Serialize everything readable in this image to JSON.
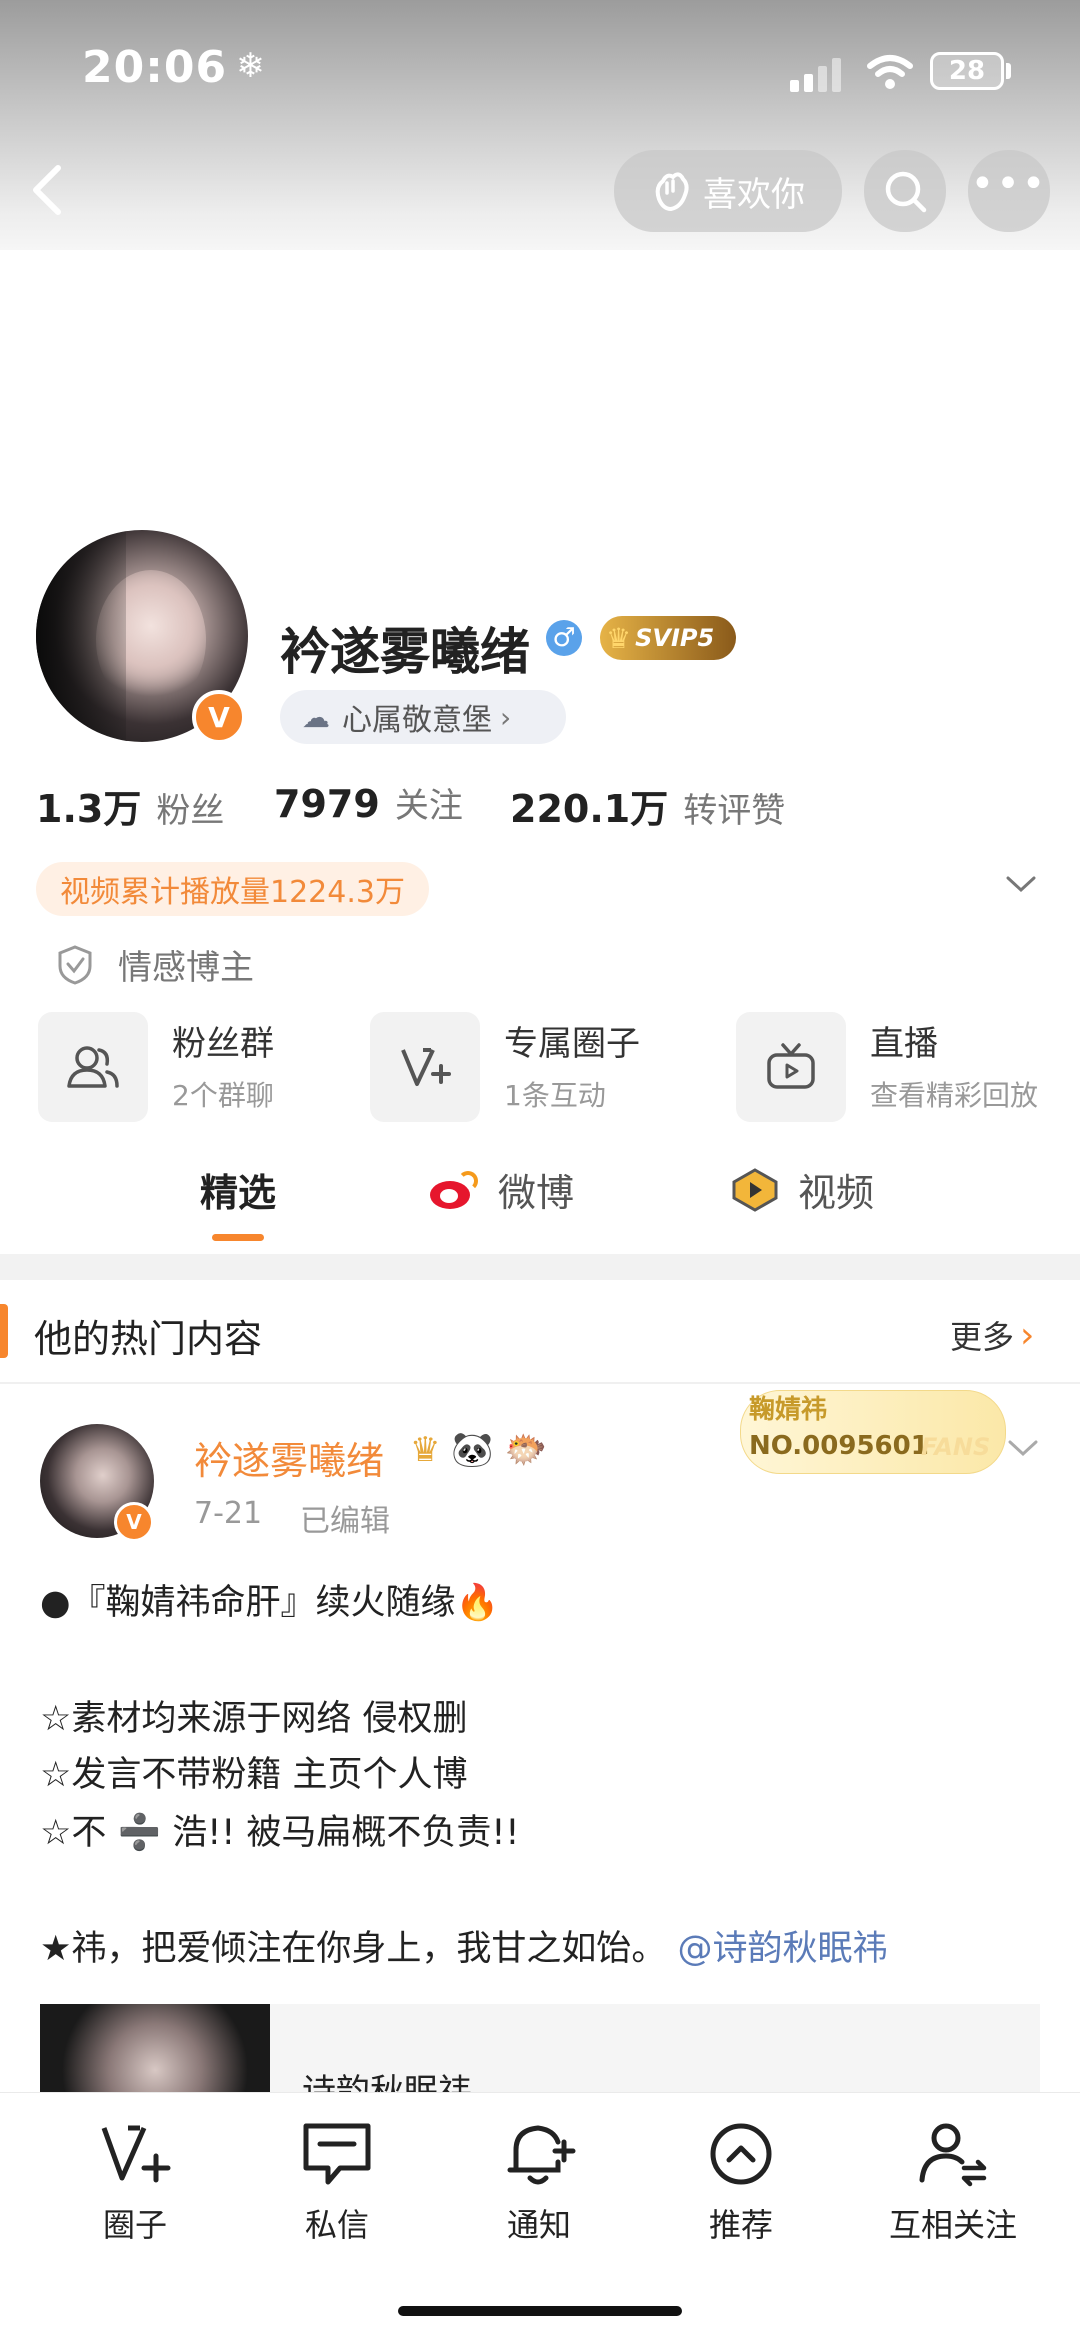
{
  "status_bar": {
    "time": "20:06",
    "battery": "28"
  },
  "header": {
    "like_button_label": "喜欢你"
  },
  "profile": {
    "name": "衿遂雾曦绪",
    "vip_badge": "SVIP5",
    "verified_badge": "V",
    "group_label": "心属敬意堡",
    "stats": [
      {
        "value": "1.3万",
        "label": "粉丝"
      },
      {
        "value": "7979",
        "label": "关注"
      },
      {
        "value": "220.1万",
        "label": "转评赞"
      }
    ],
    "video_plays": "视频累计播放量1224.3万",
    "category": "情感博主"
  },
  "feature_cards": [
    {
      "title": "粉丝群",
      "subtitle": "2个群聊",
      "icon": "group-icon"
    },
    {
      "title": "专属圈子",
      "subtitle": "1条互动",
      "icon": "circle-v-icon"
    },
    {
      "title": "直播",
      "subtitle": "查看精彩回放",
      "icon": "tv-icon"
    }
  ],
  "tabs": [
    {
      "label": "精选",
      "active": true
    },
    {
      "label": "微博",
      "active": false
    },
    {
      "label": "视频",
      "active": false
    }
  ],
  "section": {
    "title": "他的热门内容",
    "more": "更多"
  },
  "post": {
    "author": "衿遂雾曦绪",
    "date": "7-21",
    "edited": "已编辑",
    "fans_card": {
      "name": "鞠婧祎",
      "number": "NO.0095601",
      "tag": "FANS"
    },
    "lines": [
      "●『鞠婧祎命肝』续火随缘🔥",
      "☆素材均来源于网络 侵权删",
      "☆发言不带粉籍 主页个人博",
      "☆不 ➗ 浩!! 被马扁概不负责!!",
      "★祎，把爱倾注在你身上，我甘之如饴。"
    ],
    "mention": "@诗韵秋眠祎",
    "preview_title": "诗韵秋眠祎"
  },
  "bottom_nav": [
    {
      "label": "圈子",
      "icon": "circle-v-icon"
    },
    {
      "label": "私信",
      "icon": "chat-icon"
    },
    {
      "label": "通知",
      "icon": "bell-icon"
    },
    {
      "label": "推荐",
      "icon": "up-arrow-circle-icon"
    },
    {
      "label": "互相关注",
      "icon": "mutual-follow-icon"
    }
  ],
  "colors": {
    "accent": "#f7862d",
    "link": "#5b7bb8",
    "tab_active": "#222222",
    "tab_underline": "#f7862d"
  }
}
